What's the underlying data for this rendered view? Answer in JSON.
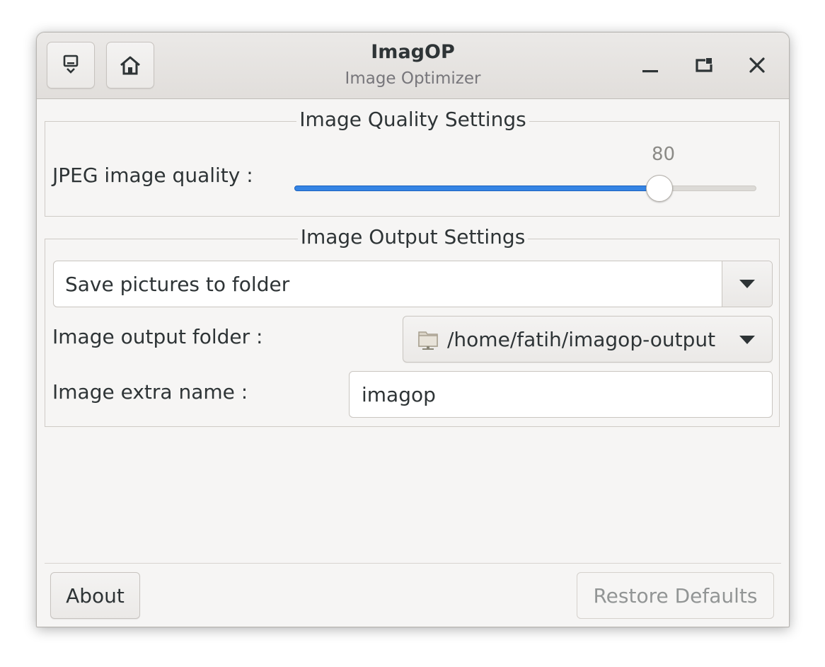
{
  "window": {
    "title": "ImagOP",
    "subtitle": "Image Optimizer"
  },
  "header": {
    "left_buttons": [
      "download-menu-icon",
      "home-icon"
    ],
    "controls": [
      "minimize-icon",
      "maximize-icon",
      "close-icon"
    ]
  },
  "quality_settings": {
    "legend": "Image Quality Settings",
    "jpeg_label": "JPEG image quality :",
    "jpeg_quality": "80",
    "jpeg_quality_fraction": 0.8
  },
  "output_settings": {
    "legend": "Image Output Settings",
    "save_mode": "Save pictures to folder",
    "output_folder_label": "Image output folder :",
    "output_folder": "/home/fatih/imagop-output",
    "extra_name_label": "Image extra name :",
    "extra_name": "imagop"
  },
  "footer": {
    "about_label": "About",
    "restore_label": "Restore Defaults"
  },
  "colors": {
    "accent": "#3584e4",
    "window_bg": "#f6f5f4"
  }
}
